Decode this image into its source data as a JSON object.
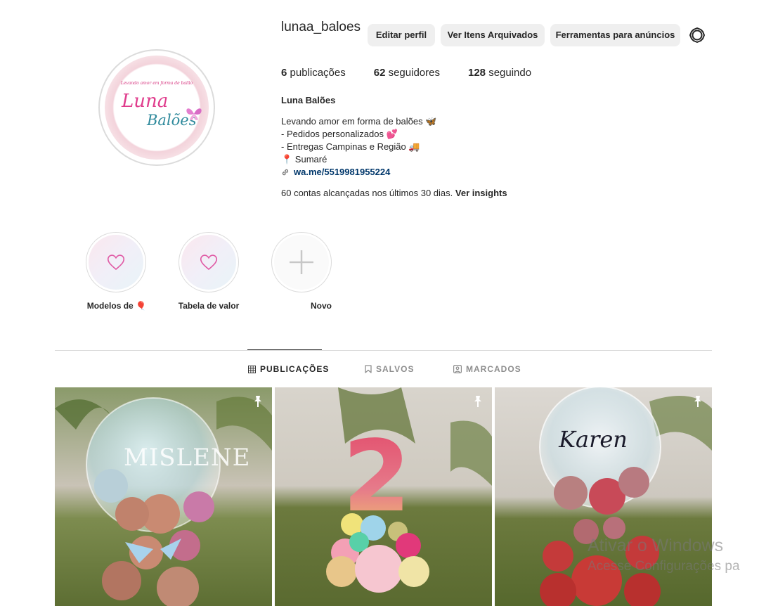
{
  "profile": {
    "username": "lunaa_baloes",
    "logo_text": {
      "tagline": "Levando amor em forma de balão",
      "line1": "Luna",
      "line2": "Balões"
    },
    "buttons": {
      "edit": "Editar perfil",
      "archive": "Ver Itens Arquivados",
      "tools": "Ferramentas para anúncios"
    },
    "settings_icon": "settings-gear-icon",
    "stats": [
      {
        "count": "6",
        "label": "publicações"
      },
      {
        "count": "62",
        "label": "seguidores"
      },
      {
        "count": "128",
        "label": "seguindo"
      }
    ],
    "bio": {
      "name": "Luna Balões",
      "lines": [
        "Levando amor em forma de balões 🦋",
        "- Pedidos personalizados 💕",
        "- Entregas Campinas e Região 🚚",
        "📍 Sumaré"
      ],
      "link": "wa.me/5519981955224"
    },
    "insights": {
      "text": "60 contas alcançadas nos últimos 30 dias.",
      "link": "Ver insights"
    }
  },
  "highlights": [
    {
      "label": "Modelos de 🎈",
      "icon": "heart-icon"
    },
    {
      "label": "Tabela de valor",
      "icon": "heart-icon"
    },
    {
      "label": "Novo",
      "icon": "plus-icon"
    }
  ],
  "tabs": [
    {
      "label": "PUBLICAÇÕES",
      "icon": "grid-icon",
      "active": true
    },
    {
      "label": "SALVOS",
      "icon": "bookmark-icon",
      "active": false
    },
    {
      "label": "MARCADOS",
      "icon": "tagged-icon",
      "active": false
    }
  ],
  "posts": [
    {
      "pinned": true,
      "caption": "MISLENE"
    },
    {
      "pinned": true,
      "caption": "2"
    },
    {
      "pinned": true,
      "caption": "Karen"
    }
  ],
  "watermark": {
    "line1": "Ativar o Windows",
    "line2": "Acesse Configurações pa"
  },
  "colors": {
    "text": "#262626",
    "muted": "#8e8e8e",
    "link": "#00376b",
    "button_bg": "#efefef",
    "border": "#dbdbdb"
  }
}
